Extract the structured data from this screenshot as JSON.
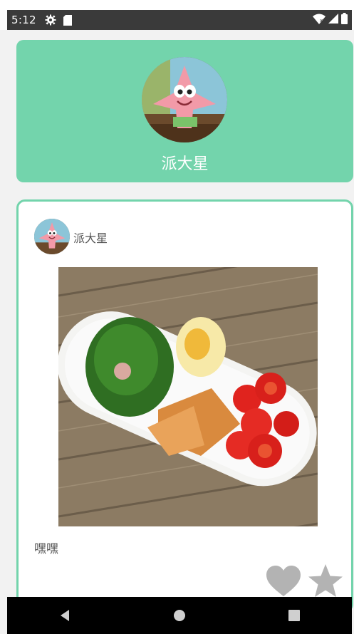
{
  "status_bar": {
    "time": "5:12",
    "icons": [
      "gear-icon",
      "sd-card-icon",
      "wifi-icon",
      "signal-icon",
      "battery-icon"
    ]
  },
  "profile": {
    "name": "派大星",
    "avatar_icon": "patrick-avatar"
  },
  "post": {
    "author": "派大星",
    "avatar_icon": "patrick-avatar",
    "image_icon": "salad-plate-photo",
    "text": "嘿嘿",
    "actions": {
      "like_icon": "heart-icon",
      "favorite_icon": "star-icon"
    }
  },
  "nav_bar": {
    "buttons": [
      "back-icon",
      "home-icon",
      "recents-icon"
    ]
  },
  "colors": {
    "accent": "#73d4ac",
    "action_gray": "#b3b3b3",
    "status_bar": "#3a3a3a",
    "nav_bar": "#000000"
  }
}
